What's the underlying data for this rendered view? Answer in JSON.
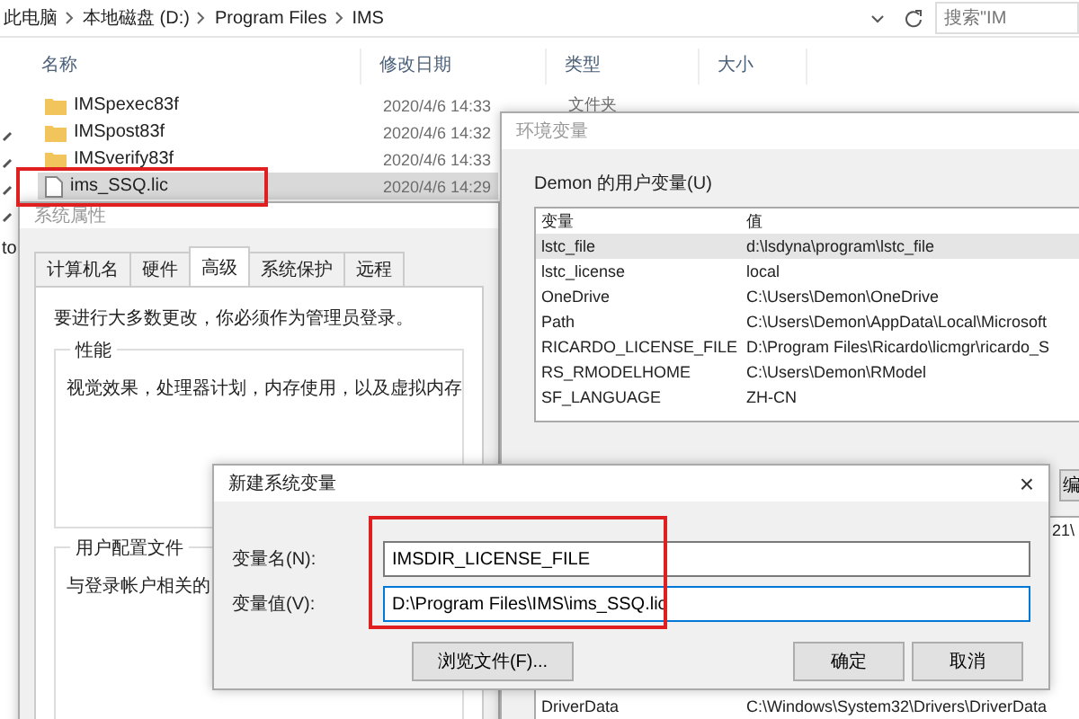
{
  "explorer": {
    "breadcrumb": [
      "此电脑",
      "本地磁盘 (D:)",
      "Program Files",
      "IMS"
    ],
    "search": {
      "placeholder": "搜索\"IM"
    },
    "nav_fragment": "to",
    "columns": [
      "名称",
      "修改日期",
      "类型",
      "大小"
    ],
    "rows": [
      {
        "kind": "folder",
        "name": "IMSpexec83f",
        "date": "2020/4/6 14:33",
        "type": "文件夹",
        "selected": false
      },
      {
        "kind": "folder",
        "name": "IMSpost83f",
        "date": "2020/4/6 14:32",
        "selected": false
      },
      {
        "kind": "folder",
        "name": "IMSverify83f",
        "date": "2020/4/6 14:33",
        "selected": false
      },
      {
        "kind": "file",
        "name": "ims_SSQ.lic",
        "date": "2020/4/6 14:29",
        "selected": true
      }
    ]
  },
  "system_properties": {
    "title": "系统属性",
    "tabs": [
      {
        "label": "计算机名",
        "selected": false
      },
      {
        "label": "硬件",
        "selected": false
      },
      {
        "label": "高级",
        "selected": true
      },
      {
        "label": "系统保护",
        "selected": false
      },
      {
        "label": "远程",
        "selected": false
      }
    ],
    "notice": "要进行大多数更改，你必须作为管理员登录。",
    "performance": {
      "title": "性能",
      "text": "视觉效果，处理器计划，内存使用，以及虚拟内存"
    },
    "user_profiles": {
      "title": "用户配置文件",
      "text": "与登录帐户相关的"
    }
  },
  "environment_variables": {
    "title": "环境变量",
    "user_section": "Demon 的用户变量(U)",
    "columns": [
      "变量",
      "值"
    ],
    "user_vars": [
      {
        "name": "lstc_file",
        "value": "d:\\lsdyna\\program\\lstc_file",
        "selected": true
      },
      {
        "name": "lstc_license",
        "value": "local",
        "selected": false
      },
      {
        "name": "OneDrive",
        "value": "C:\\Users\\Demon\\OneDrive",
        "selected": false
      },
      {
        "name": "Path",
        "value": "C:\\Users\\Demon\\AppData\\Local\\Microsoft",
        "selected": false
      },
      {
        "name": "RICARDO_LICENSE_FILE",
        "value": "D:\\Program Files\\Ricardo\\licmgr\\ricardo_S",
        "selected": false
      },
      {
        "name": "RS_RMODELHOME",
        "value": "C:\\Users\\Demon\\RModel",
        "selected": false
      },
      {
        "name": "SF_LANGUAGE",
        "value": "ZH-CN",
        "selected": false
      }
    ],
    "edit_button": "编",
    "system_value_fragment": "21\\",
    "system_vars": [
      {
        "name": "DriverData",
        "value": "C:\\Windows\\System32\\Drivers\\DriverData"
      }
    ]
  },
  "new_variable_dialog": {
    "title": "新建系统变量",
    "close": "×",
    "name_label": "变量名(N):",
    "name_value": "IMSDIR_LICENSE_FILE",
    "value_label": "变量值(V):",
    "value_value": "D:\\Program Files\\IMS\\ims_SSQ.lic",
    "buttons": [
      {
        "kind": "browse",
        "label": "浏览文件(F)..."
      },
      {
        "kind": "ok",
        "label": "确定"
      },
      {
        "kind": "cancel",
        "label": "取消"
      }
    ]
  }
}
